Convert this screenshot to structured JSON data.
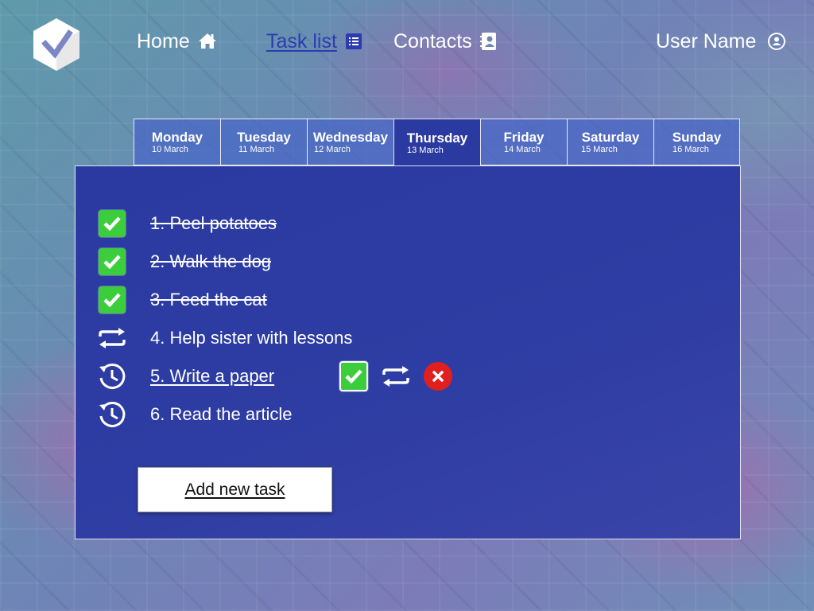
{
  "app": {
    "logo_icon": "check-hexagon-logo",
    "accent_color": "#2c3cb0"
  },
  "nav": {
    "home": {
      "label": "Home",
      "icon": "home-icon"
    },
    "tasks": {
      "label": "Task list",
      "icon": "list-icon",
      "active": true
    },
    "contacts": {
      "label": "Contacts",
      "icon": "address-book-icon"
    },
    "user": {
      "label": "User Name",
      "icon": "user-avatar-icon"
    }
  },
  "days": [
    {
      "day": "Monday",
      "date": "10 March"
    },
    {
      "day": "Tuesday",
      "date": "11 March"
    },
    {
      "day": "Wednesday",
      "date": "12 March"
    },
    {
      "day": "Thursday",
      "date": "13 March",
      "active": true
    },
    {
      "day": "Friday",
      "date": "14 March"
    },
    {
      "day": "Saturday",
      "date": "15 March"
    },
    {
      "day": "Sunday",
      "date": "16 March"
    }
  ],
  "tasks": [
    {
      "text": "1. Peel potatoes",
      "status": "done",
      "icon": "checkbox-checked-icon"
    },
    {
      "text": "2. Walk the dog",
      "status": "done",
      "icon": "checkbox-checked-icon"
    },
    {
      "text": "3. Feed the cat",
      "status": "done",
      "icon": "checkbox-checked-icon"
    },
    {
      "text": "4. Help sister with lessons",
      "status": "repeat",
      "icon": "repeat-icon"
    },
    {
      "text": "5. Write a paper",
      "status": "pending",
      "icon": "clock-icon"
    },
    {
      "text": "6. Read the article",
      "status": "pending",
      "icon": "clock-icon"
    }
  ],
  "task_actions": {
    "check": "check-icon",
    "repeat": "repeat-icon",
    "delete": "delete-icon"
  },
  "add_task": {
    "label": "Add new task"
  },
  "colors": {
    "check_green": "#3ccd3c",
    "delete_red": "#e0201f",
    "panel_blue": "#2b3aa0"
  }
}
